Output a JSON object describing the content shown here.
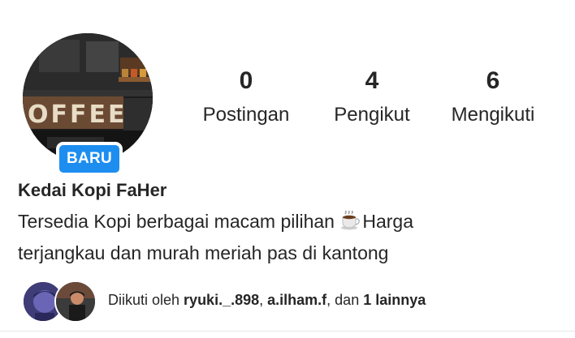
{
  "profile": {
    "badge": "BARU",
    "name": "Kedai Kopi FaHer",
    "bio_line1_before": "Tersedia Kopi berbagai macam pilihan ",
    "bio_line1_after": "Harga",
    "bio_line2": "terjangkau dan murah meriah pas di kantong",
    "bio_icon": "hot-beverage-icon",
    "avatar_sign_text": "OFFEE"
  },
  "stats": {
    "posts": {
      "value": "0",
      "label": "Postingan"
    },
    "followers": {
      "value": "4",
      "label": "Pengikut"
    },
    "following": {
      "value": "6",
      "label": "Mengikuti"
    }
  },
  "followed_by": {
    "prefix": "Diikuti oleh ",
    "user1": "ryuki._.898",
    "sep": ", ",
    "user2": "a.ilham.f",
    "middle": ", dan ",
    "others": "1 lainnya"
  },
  "colors": {
    "badge": "#1d8ef0",
    "text": "#262626"
  }
}
